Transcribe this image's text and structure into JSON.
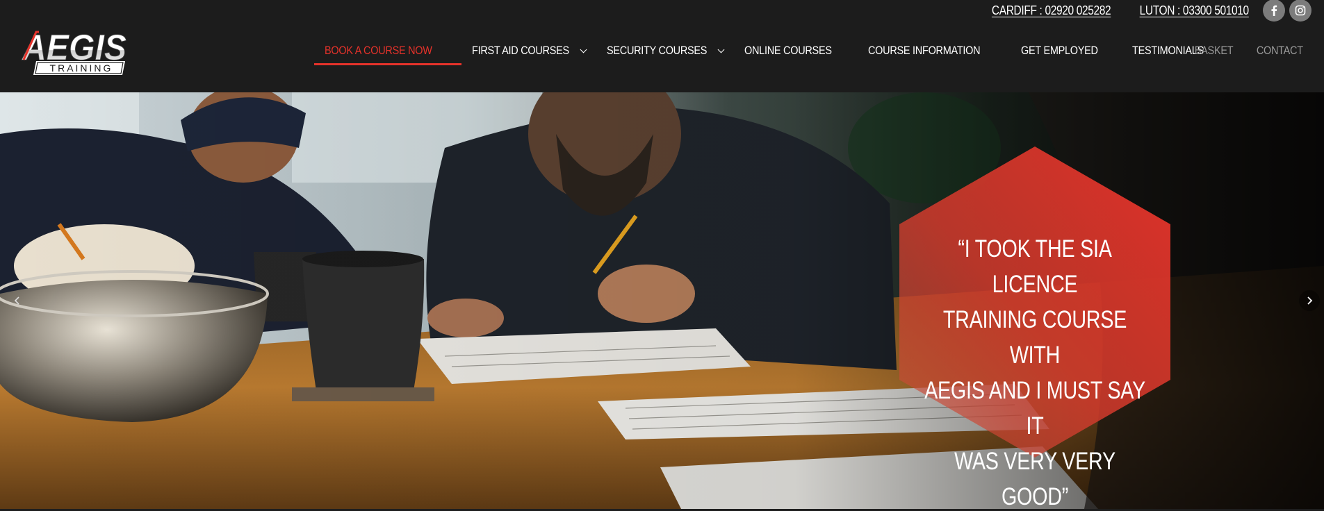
{
  "header": {
    "phones": [
      {
        "label": "CARDIFF : 02920 025282"
      },
      {
        "label": "LUTON : 03300 501010"
      }
    ],
    "socials": [
      {
        "icon": "facebook-icon",
        "letter": "f"
      },
      {
        "icon": "instagram-icon"
      }
    ],
    "logo": {
      "word": "AEGIS",
      "sub": "TRAINING"
    },
    "nav": [
      {
        "label": "BOOK A COURSE NOW",
        "active": true
      },
      {
        "label": "FIRST AID COURSES",
        "dropdown": true
      },
      {
        "label": "SECURITY COURSES",
        "dropdown": true
      },
      {
        "label": "ONLINE COURSES"
      },
      {
        "label": "COURSE INFORMATION"
      },
      {
        "label": "GET EMPLOYED"
      },
      {
        "label": "TESTIMONIALS"
      }
    ],
    "utility": [
      {
        "label": "BASKET"
      },
      {
        "label": "CONTACT"
      }
    ]
  },
  "hero": {
    "quote": "“I TOOK THE SIA LICENCE TRAINING COURSE WITH AEGIS AND I MUST SAY IT WAS VERY VERY GOOD”",
    "quote_lines": [
      "“I TOOK THE SIA LICENCE",
      "TRAINING COURSE WITH",
      "AEGIS AND I MUST SAY IT",
      "WAS VERY VERY GOOD”"
    ],
    "prev_icon": "chevron-left-icon",
    "next_icon": "chevron-right-icon"
  },
  "colors": {
    "accent": "#e5322a",
    "header_bg": "#1c1c1c",
    "muted": "#9a9a9a"
  }
}
